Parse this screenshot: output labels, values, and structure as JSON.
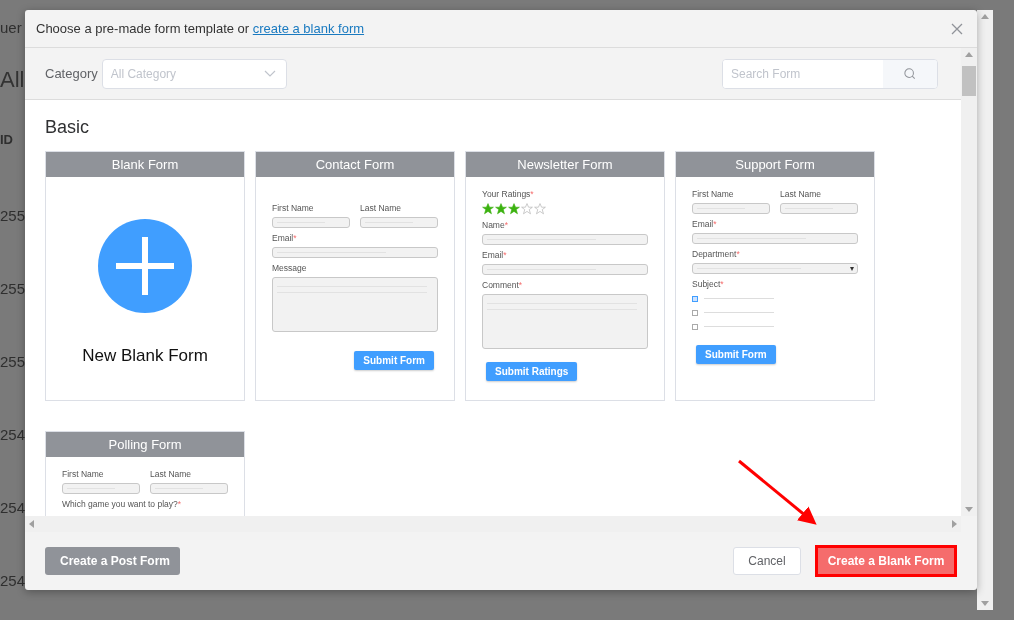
{
  "backdrop": {
    "texts": [
      "uer",
      "All",
      "ID",
      "255",
      "255",
      "255",
      "254",
      "254",
      "254"
    ]
  },
  "dialog": {
    "title": "Choose a pre-made form template or",
    "title_link": "create a blank form",
    "category": {
      "label": "Category",
      "placeholder": "All Category"
    },
    "search": {
      "placeholder": "Search Form"
    },
    "section": "Basic",
    "templates": [
      {
        "title": "Blank Form",
        "kind": "blank",
        "caption": "New Blank Form"
      },
      {
        "title": "Contact Form",
        "kind": "preview",
        "fields": [
          {
            "kind": "pair",
            "labels": [
              "First Name",
              "Last Name"
            ]
          },
          {
            "kind": "input",
            "label": "Email",
            "mark": "*"
          },
          {
            "kind": "textarea",
            "label": "Message"
          }
        ],
        "submit": {
          "label": "Submit Form"
        }
      },
      {
        "title": "Newsletter Form",
        "kind": "preview",
        "fields": [
          {
            "kind": "rating",
            "label": "Your Ratings",
            "mark": "*",
            "stars": 3
          },
          {
            "kind": "input",
            "label": "Name",
            "mark": "*"
          },
          {
            "kind": "input",
            "label": "Email",
            "mark": "*"
          },
          {
            "kind": "textarea",
            "label": "Comment",
            "mark": "*"
          }
        ],
        "submit": {
          "label": "Submit Ratings"
        }
      },
      {
        "title": "Support Form",
        "kind": "preview",
        "fields": [
          {
            "kind": "pair",
            "labels": [
              "First Name",
              "Last Name"
            ]
          },
          {
            "kind": "input",
            "label": "Email",
            "mark": "*"
          },
          {
            "kind": "select",
            "label": "Department",
            "mark": "*"
          },
          {
            "kind": "checklist",
            "label": "Subject",
            "mark": "*",
            "items": [
              {
                "checked": true
              },
              {
                "checked": false
              },
              {
                "checked": false
              }
            ]
          }
        ],
        "submit": {
          "label": "Submit Form"
        }
      },
      {
        "title": "Polling Form",
        "kind": "preview",
        "fields": [
          {
            "kind": "pair",
            "labels": [
              "First Name",
              "Last Name"
            ]
          },
          {
            "kind": "text",
            "label": "Which game you want to play?",
            "mark": "*"
          }
        ]
      }
    ],
    "footer": {
      "secondary": "Create a Post Form",
      "cancel": "Cancel",
      "primary": {
        "label": "Create a Blank Form",
        "highlighted": true
      }
    }
  }
}
